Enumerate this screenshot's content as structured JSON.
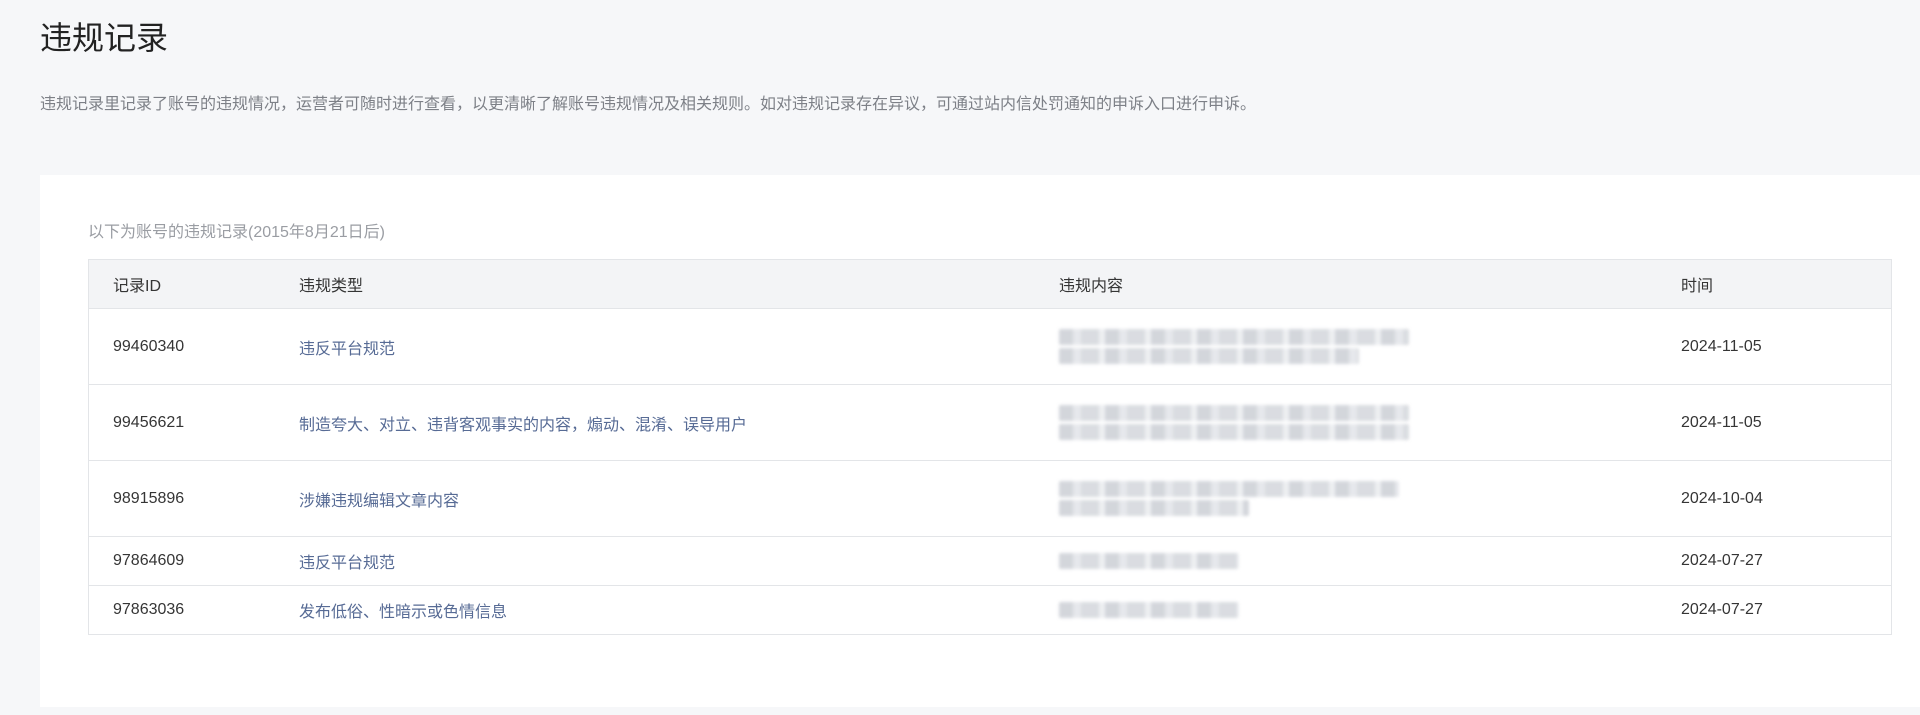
{
  "page": {
    "title": "违规记录",
    "description": "违规记录里记录了账号的违规情况，运营者可随时进行查看，以更清晰了解账号违规情况及相关规则。如对违规记录存在异议，可通过站内信处罚通知的申诉入口进行申诉。"
  },
  "records": {
    "hint": "以下为账号的违规记录(2015年8月21日后)",
    "headers": {
      "id": "记录ID",
      "type": "违规类型",
      "content": "违规内容",
      "time": "时间"
    },
    "rows": [
      {
        "id": "99460340",
        "type": "违反平台规范",
        "time": "2024-11-05",
        "content_lines": 2
      },
      {
        "id": "99456621",
        "type": "制造夸大、对立、违背客观事实的内容，煽动、混淆、误导用户",
        "time": "2024-11-05",
        "content_lines": 2
      },
      {
        "id": "98915896",
        "type": "涉嫌违规编辑文章内容",
        "time": "2024-10-04",
        "content_lines": 2
      },
      {
        "id": "97864609",
        "type": "违反平台规范",
        "time": "2024-07-27",
        "content_lines": 1
      },
      {
        "id": "97863036",
        "type": "发布低俗、性暗示或色情信息",
        "time": "2024-07-27",
        "content_lines": 1
      }
    ]
  }
}
